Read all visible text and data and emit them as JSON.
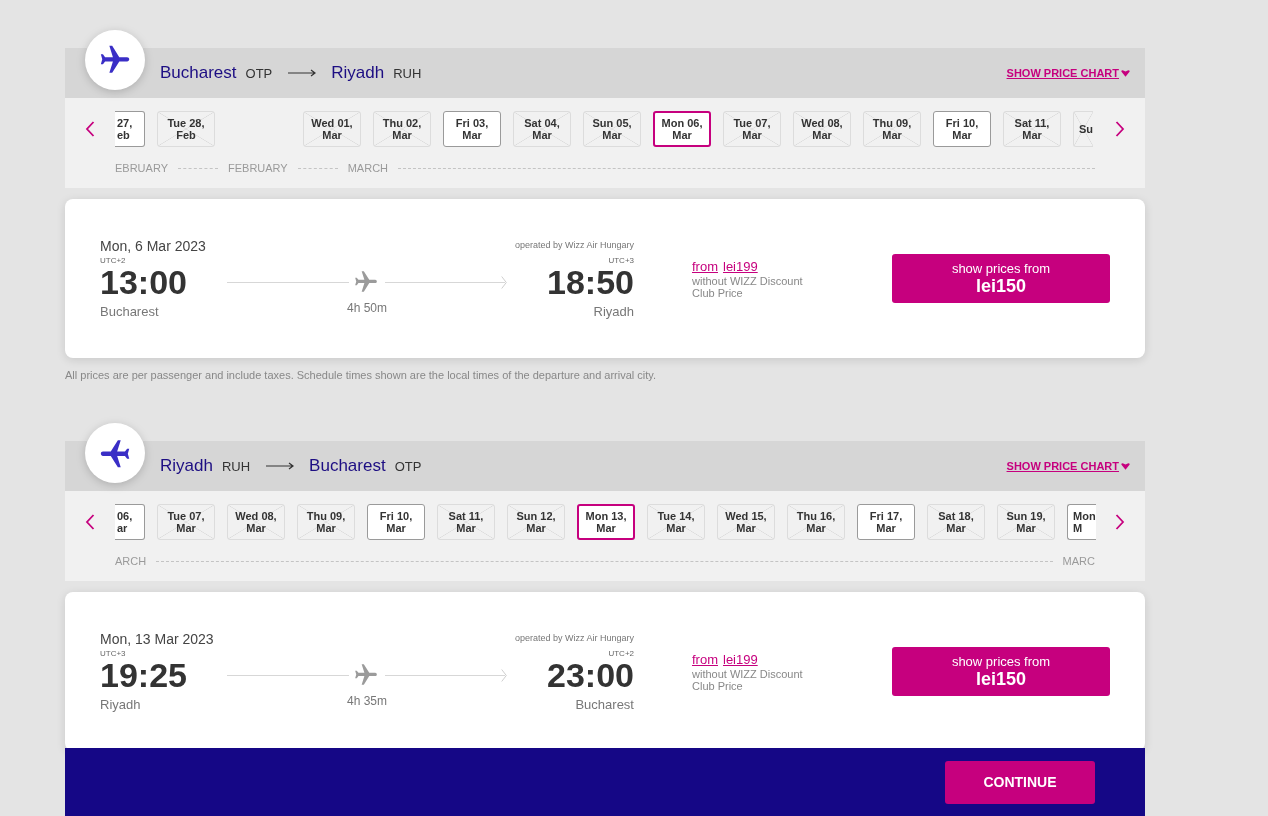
{
  "flights": [
    {
      "kind": "outbound",
      "route": {
        "from_city": "Bucharest",
        "from_code": "OTP",
        "to_city": "Riyadh",
        "to_code": "RUH"
      },
      "price_chart_link": "SHOW PRICE CHART",
      "dates": [
        {
          "kind": "partial",
          "day": "27,",
          "month": "eb",
          "available": true,
          "selected": false
        },
        {
          "kind": "full",
          "day": "Tue 28,",
          "month": "Feb",
          "available": false,
          "selected": false
        },
        {
          "kind": "full",
          "day": "Wed 01,",
          "month": "Mar",
          "available": false,
          "selected": false
        },
        {
          "kind": "full",
          "day": "Thu 02,",
          "month": "Mar",
          "available": false,
          "selected": false
        },
        {
          "kind": "full",
          "day": "Fri 03,",
          "month": "Mar",
          "available": true,
          "selected": false
        },
        {
          "kind": "full",
          "day": "Sat 04,",
          "month": "Mar",
          "available": false,
          "selected": false
        },
        {
          "kind": "full",
          "day": "Sun 05,",
          "month": "Mar",
          "available": false,
          "selected": false
        },
        {
          "kind": "full",
          "day": "Mon 06,",
          "month": "Mar",
          "available": true,
          "selected": true
        },
        {
          "kind": "full",
          "day": "Tue 07,",
          "month": "Mar",
          "available": false,
          "selected": false
        },
        {
          "kind": "full",
          "day": "Wed 08,",
          "month": "Mar",
          "available": false,
          "selected": false
        },
        {
          "kind": "full",
          "day": "Thu 09,",
          "month": "Mar",
          "available": false,
          "selected": false
        },
        {
          "kind": "full",
          "day": "Fri 10,",
          "month": "Mar",
          "available": true,
          "selected": false
        },
        {
          "kind": "full",
          "day": "Sat 11,",
          "month": "Mar",
          "available": false,
          "selected": false
        },
        {
          "kind": "partial",
          "day": "Su",
          "available": false,
          "selected": false
        }
      ],
      "months": [
        {
          "kind": "partial",
          "label": "EBRUARY"
        },
        {
          "kind": "full",
          "label": "FEBRUARY"
        },
        {
          "kind": "full",
          "label": "MARCH"
        }
      ],
      "flight": {
        "date": "Mon, 6 Mar 2023",
        "operator": "operated by Wizz Air Hungary",
        "departure": {
          "utc": "UTC+2",
          "time": "13:00",
          "city": "Bucharest"
        },
        "duration": "4h 50m",
        "arrival": {
          "utc": "UTC+3",
          "time": "18:50",
          "city": "Riyadh"
        },
        "from_label": "from",
        "from_price": "lei199",
        "price_note": "without WIZZ Discount Club Price",
        "button": {
          "label": "show prices from",
          "price": "lei150"
        }
      },
      "note": "All prices are per passenger and include taxes. Schedule times shown are the local times of the departure and arrival city."
    },
    {
      "kind": "return",
      "route": {
        "from_city": "Riyadh",
        "from_code": "RUH",
        "to_city": "Bucharest",
        "to_code": "OTP"
      },
      "price_chart_link": "SHOW PRICE CHART",
      "dates": [
        {
          "kind": "partial",
          "day": "06,",
          "month": "ar",
          "available": true,
          "selected": false
        },
        {
          "kind": "full",
          "day": "Tue 07,",
          "month": "Mar",
          "available": false,
          "selected": false
        },
        {
          "kind": "full",
          "day": "Wed 08,",
          "month": "Mar",
          "available": false,
          "selected": false
        },
        {
          "kind": "full",
          "day": "Thu 09,",
          "month": "Mar",
          "available": false,
          "selected": false
        },
        {
          "kind": "full",
          "day": "Fri 10,",
          "month": "Mar",
          "available": true,
          "selected": false
        },
        {
          "kind": "full",
          "day": "Sat 11,",
          "month": "Mar",
          "available": false,
          "selected": false
        },
        {
          "kind": "full",
          "day": "Sun 12,",
          "month": "Mar",
          "available": false,
          "selected": false
        },
        {
          "kind": "full",
          "day": "Mon 13,",
          "month": "Mar",
          "available": true,
          "selected": true
        },
        {
          "kind": "full",
          "day": "Tue 14,",
          "month": "Mar",
          "available": false,
          "selected": false
        },
        {
          "kind": "full",
          "day": "Wed 15,",
          "month": "Mar",
          "available": false,
          "selected": false
        },
        {
          "kind": "full",
          "day": "Thu 16,",
          "month": "Mar",
          "available": false,
          "selected": false
        },
        {
          "kind": "full",
          "day": "Fri 17,",
          "month": "Mar",
          "available": true,
          "selected": false
        },
        {
          "kind": "full",
          "day": "Sat 18,",
          "month": "Mar",
          "available": false,
          "selected": false
        },
        {
          "kind": "full",
          "day": "Sun 19,",
          "month": "Mar",
          "available": false,
          "selected": false
        },
        {
          "kind": "partial",
          "day": "Mon",
          "month": "M",
          "available": true,
          "selected": false
        }
      ],
      "months": [
        {
          "kind": "partial",
          "label": "ARCH"
        },
        {
          "kind": "partial",
          "label": "MARC"
        }
      ],
      "flight": {
        "date": "Mon, 13 Mar 2023",
        "operator": "operated by Wizz Air Hungary",
        "departure": {
          "utc": "UTC+3",
          "time": "19:25",
          "city": "Riyadh"
        },
        "duration": "4h 35m",
        "arrival": {
          "utc": "UTC+2",
          "time": "23:00",
          "city": "Bucharest"
        },
        "from_label": "from",
        "from_price": "lei199",
        "price_note": "without WIZZ Discount Club Price",
        "button": {
          "label": "show prices from",
          "price": "lei150"
        }
      }
    }
  ],
  "continue_button": "CONTINUE"
}
